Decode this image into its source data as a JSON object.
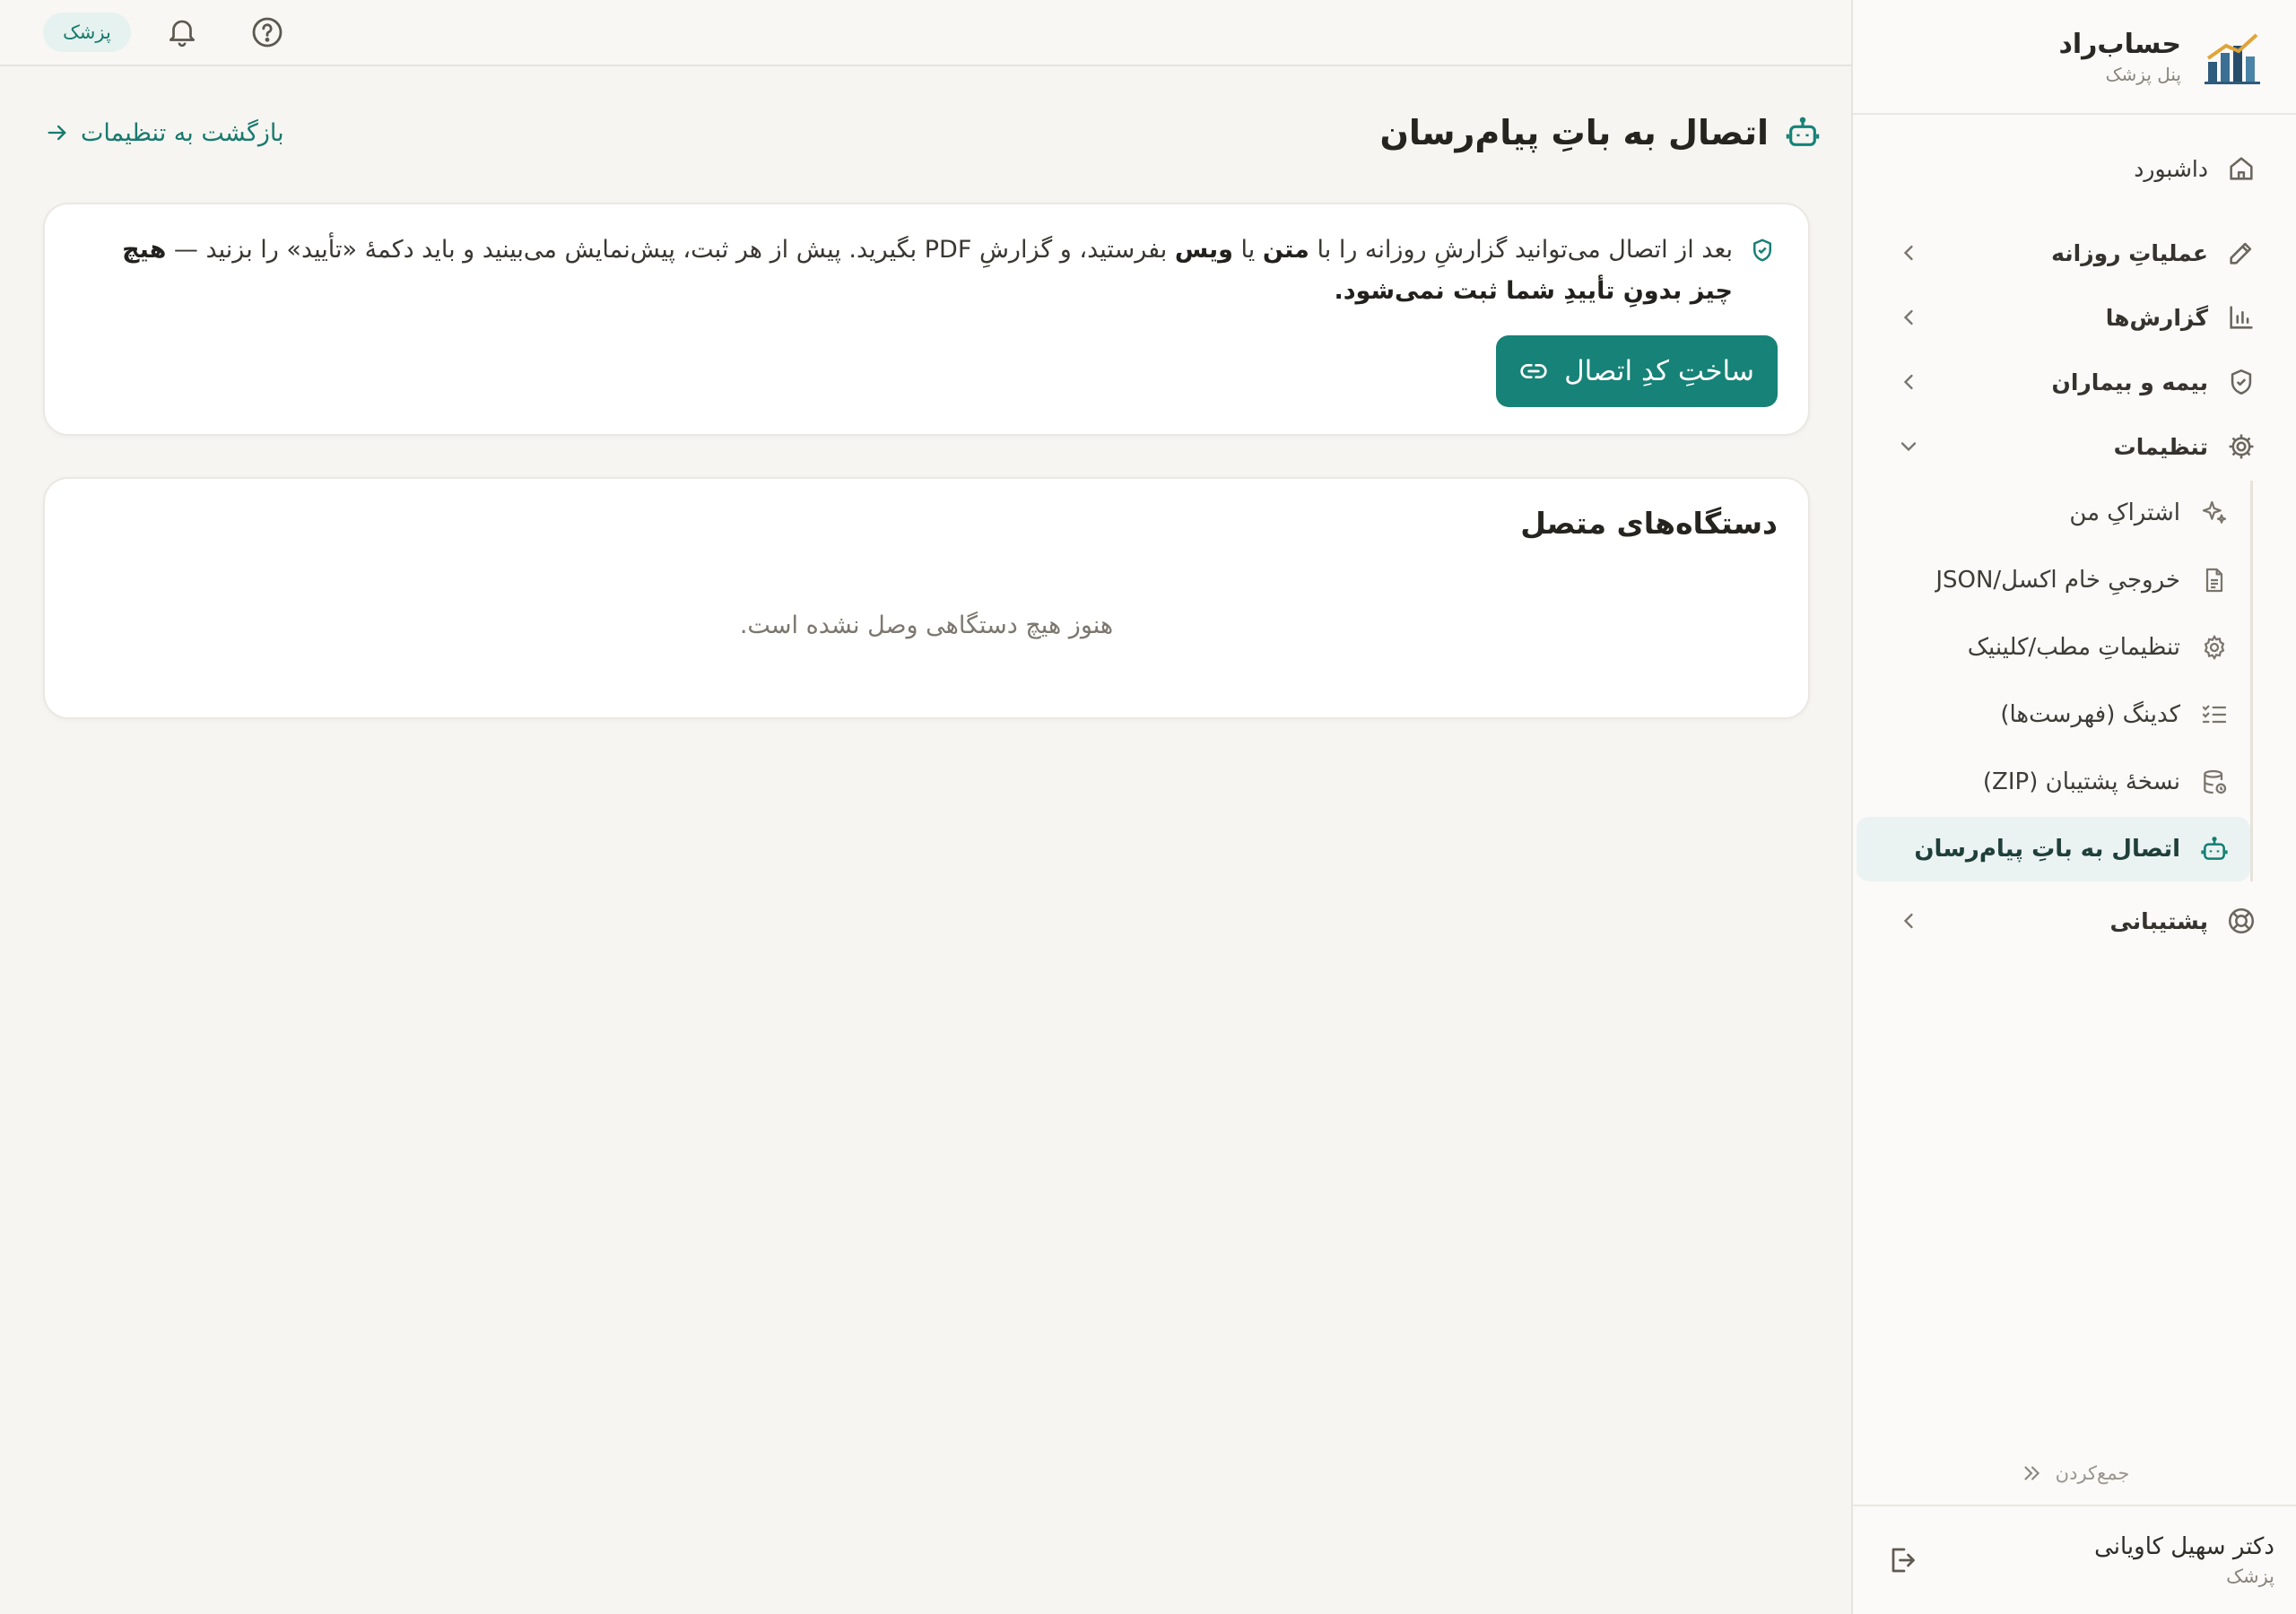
{
  "brand": {
    "name": "حساب‌راد",
    "subtitle": "پنل پزشک"
  },
  "topbar": {
    "role_badge": "پزشک",
    "icons": [
      "bell-icon",
      "help-icon"
    ]
  },
  "sidebar": {
    "home": {
      "label": "داشبورد",
      "icon": "home-icon"
    },
    "groups": [
      {
        "label": "عملیاتِ روزانه",
        "icon": "pencil-icon",
        "expanded": false
      },
      {
        "label": "گزارش‌ها",
        "icon": "bar-chart-icon",
        "expanded": false
      },
      {
        "label": "بیمه و بیماران",
        "icon": "shield-icon",
        "expanded": false
      },
      {
        "label": "تنظیمات",
        "icon": "gear-icon",
        "expanded": true
      }
    ],
    "settings_items": [
      {
        "label": "اشتراکِ من",
        "icon": "sparkles-icon",
        "active": false
      },
      {
        "label": "خروجیِ خام اکسل/JSON",
        "icon": "file-icon",
        "active": false
      },
      {
        "label": "تنظیماتِ مطب/کلینیک",
        "icon": "cog-icon",
        "active": false
      },
      {
        "label": "کدینگ (فهرست‌ها)",
        "icon": "list-check-icon",
        "active": false
      },
      {
        "label": "نسخهٔ پشتیبان (ZIP)",
        "icon": "database-icon",
        "active": false
      },
      {
        "label": "اتصال به باتِ پیام‌رسان",
        "icon": "bot-icon",
        "active": true
      }
    ],
    "support": {
      "label": "پشتیبانی",
      "icon": "lifebuoy-icon"
    },
    "collapse_label": "جمع‌کردن",
    "user": {
      "name": "دکتر سهیل کاویانی",
      "role": "پزشک"
    }
  },
  "page": {
    "title": "اتصال به باتِ پیام‌رسان",
    "back_link": "بازگشت به تنظیمات",
    "info": {
      "p1": "بعد از اتصال می‌توانید گزارشِ روزانه را با ",
      "b1": "متن",
      "p2": " یا ",
      "b2": "ویس",
      "p3": " بفرستید، و گزارشِ PDF بگیرید. پیش از هر ثبت، پیش‌نمایش می‌بینید و باید دکمهٔ «تأیید» را بزنید — ",
      "b3": "هیچ چیز بدونِ تأییدِ شما ثبت نمی‌شود."
    },
    "connect_button": "ساختِ کدِ اتصال",
    "devices": {
      "title": "دستگاه‌های متصل",
      "empty": "هنوز هیچ دستگاهی وصل نشده است."
    }
  },
  "colors": {
    "accent": "#178277",
    "accent_soft": "#eaf3f1",
    "background": "#f6f5f1"
  }
}
